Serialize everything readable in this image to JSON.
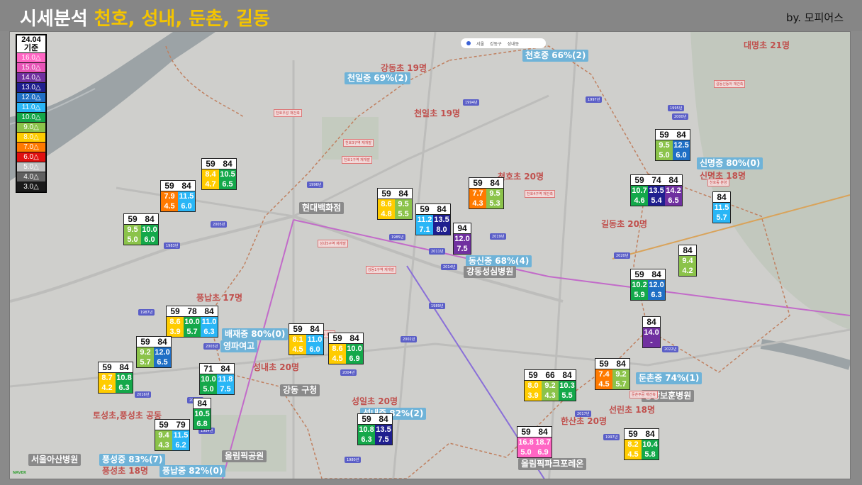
{
  "header": {
    "title_plain": "시세분석 ",
    "title_highlight": "천호, 성내, 둔촌, 길동",
    "credit": "by. 모피어스"
  },
  "legend": {
    "header": [
      "24.04",
      "기준"
    ],
    "items": [
      {
        "label": "16.0△",
        "bg": "#ff66c4",
        "fg": "#ffffff"
      },
      {
        "label": "15.0△",
        "bg": "#e754b7",
        "fg": "#ffffff"
      },
      {
        "label": "14.0△",
        "bg": "#7030a0",
        "fg": "#ffffff"
      },
      {
        "label": "13.0△",
        "bg": "#1f1f8f",
        "fg": "#ffffff"
      },
      {
        "label": "12.0△",
        "bg": "#1f6fc5",
        "fg": "#ffffff"
      },
      {
        "label": "11.0△",
        "bg": "#29b6f6",
        "fg": "#ffffff"
      },
      {
        "label": "10.0△",
        "bg": "#14a84a",
        "fg": "#ffffff"
      },
      {
        "label": "9.0△",
        "bg": "#8bc34a",
        "fg": "#ffffff"
      },
      {
        "label": "8.0△",
        "bg": "#ffcc00",
        "fg": "#ffffff"
      },
      {
        "label": "7.0△",
        "bg": "#ff7a00",
        "fg": "#ffffff"
      },
      {
        "label": "6.0△",
        "bg": "#e01010",
        "fg": "#ffffff"
      },
      {
        "label": "5.0△",
        "bg": "#c0c0c0",
        "fg": "#ffffff"
      },
      {
        "label": "4.0△",
        "bg": "#606060",
        "fg": "#ffffff"
      },
      {
        "label": "3.0△",
        "bg": "#1a1a1a",
        "fg": "#ffffff"
      }
    ]
  },
  "search": {
    "items": [
      "서울",
      "강동구",
      "성내동"
    ]
  },
  "labels": [
    {
      "text": "대명초 21명",
      "cls": "school"
    },
    {
      "text": "천호중 66%(2)",
      "cls": "mid"
    },
    {
      "text": "강동초 19명",
      "cls": "school"
    },
    {
      "text": "천일중 69%(2)",
      "cls": "mid"
    },
    {
      "text": "천일초 19명",
      "cls": "school"
    },
    {
      "text": "천호초 20명",
      "cls": "school"
    },
    {
      "text": "신명중 80%(0)",
      "cls": "mid"
    },
    {
      "text": "신명초 18명",
      "cls": "school"
    },
    {
      "text": "현대백화점",
      "cls": "place"
    },
    {
      "text": "길동초 20명",
      "cls": "school"
    },
    {
      "text": "동신중 68%(4)",
      "cls": "mid"
    },
    {
      "text": "강동성심병원",
      "cls": "place"
    },
    {
      "text": "풍납초 17명",
      "cls": "school"
    },
    {
      "text": "배재중 80%(0)",
      "cls": "mid"
    },
    {
      "text": "영파여고",
      "cls": "mid"
    },
    {
      "text": "성내초 20명",
      "cls": "school"
    },
    {
      "text": "강동 구청",
      "cls": "place"
    },
    {
      "text": "둔촌중 74%(1)",
      "cls": "mid"
    },
    {
      "text": "중앙보훈병원",
      "cls": "place"
    },
    {
      "text": "성일초 20명",
      "cls": "school"
    },
    {
      "text": "성내중 82%(2)",
      "cls": "mid"
    },
    {
      "text": "선린초 18명",
      "cls": "school"
    },
    {
      "text": "토성초,풍성초 공동",
      "cls": "school"
    },
    {
      "text": "한산초 20명",
      "cls": "school"
    },
    {
      "text": "올림픽공원",
      "cls": "place"
    },
    {
      "text": "올림픽파크포레온",
      "cls": "place"
    },
    {
      "text": "서울아산병원",
      "cls": "place"
    },
    {
      "text": "풍성중 83%(7)",
      "cls": "mid"
    },
    {
      "text": "풍성초 18명",
      "cls": "school"
    },
    {
      "text": "풍납중 82%(0)",
      "cls": "mid"
    }
  ],
  "cards": [
    {
      "sizes": [
        "59",
        "84"
      ],
      "rows": [
        [
          {
            "v": "9.5",
            "c": "#8bc34a"
          },
          {
            "v": "12.5",
            "c": "#1f6fc5"
          }
        ],
        [
          {
            "v": "5.0",
            "c": "#8bc34a"
          },
          {
            "v": "6.0",
            "c": "#1f6fc5"
          }
        ]
      ]
    },
    {
      "sizes": [
        "59",
        "84"
      ],
      "rows": [
        [
          {
            "v": "8.4",
            "c": "#ffcc00"
          },
          {
            "v": "10.5",
            "c": "#14a84a"
          }
        ],
        [
          {
            "v": "4.7",
            "c": "#ffcc00"
          },
          {
            "v": "6.5",
            "c": "#14a84a"
          }
        ]
      ]
    },
    {
      "sizes": [
        "59",
        "84"
      ],
      "rows": [
        [
          {
            "v": "7.9",
            "c": "#ff7a00"
          },
          {
            "v": "11.5",
            "c": "#29b6f6"
          }
        ],
        [
          {
            "v": "4.5",
            "c": "#ff7a00"
          },
          {
            "v": "6.0",
            "c": "#29b6f6"
          }
        ]
      ]
    },
    {
      "sizes": [
        "59",
        "84"
      ],
      "rows": [
        [
          {
            "v": "9.5",
            "c": "#8bc34a"
          },
          {
            "v": "10.0",
            "c": "#14a84a"
          }
        ],
        [
          {
            "v": "5.0",
            "c": "#8bc34a"
          },
          {
            "v": "6.0",
            "c": "#14a84a"
          }
        ]
      ]
    },
    {
      "sizes": [
        "59",
        "84"
      ],
      "rows": [
        [
          {
            "v": "8.6",
            "c": "#ffcc00"
          },
          {
            "v": "9.5",
            "c": "#8bc34a"
          }
        ],
        [
          {
            "v": "4.8",
            "c": "#ffcc00"
          },
          {
            "v": "5.5",
            "c": "#8bc34a"
          }
        ]
      ]
    },
    {
      "sizes": [
        "59",
        "84"
      ],
      "rows": [
        [
          {
            "v": "11.2",
            "c": "#29b6f6"
          },
          {
            "v": "13.5",
            "c": "#1f1f8f"
          }
        ],
        [
          {
            "v": "7.1",
            "c": "#29b6f6"
          },
          {
            "v": "8.0",
            "c": "#1f1f8f"
          }
        ]
      ]
    },
    {
      "sizes": [
        "94"
      ],
      "rows": [
        [
          {
            "v": "12.0",
            "c": "#7030a0"
          }
        ],
        [
          {
            "v": "7.5",
            "c": "#7030a0"
          }
        ]
      ]
    },
    {
      "sizes": [
        "59",
        "84"
      ],
      "rows": [
        [
          {
            "v": "7.7",
            "c": "#ff7a00"
          },
          {
            "v": "9.5",
            "c": "#8bc34a"
          }
        ],
        [
          {
            "v": "4.3",
            "c": "#ff7a00"
          },
          {
            "v": "5.3",
            "c": "#8bc34a"
          }
        ]
      ]
    },
    {
      "sizes": [
        "59",
        "74",
        "84"
      ],
      "rows": [
        [
          {
            "v": "10.7",
            "c": "#14a84a"
          },
          {
            "v": "13.5",
            "c": "#1f1f8f"
          },
          {
            "v": "14.2",
            "c": "#7030a0"
          }
        ],
        [
          {
            "v": "4.6",
            "c": "#14a84a"
          },
          {
            "v": "5.4",
            "c": "#1f1f8f"
          },
          {
            "v": "6.5",
            "c": "#7030a0"
          }
        ]
      ]
    },
    {
      "sizes": [
        "84"
      ],
      "rows": [
        [
          {
            "v": "11.5",
            "c": "#29b6f6"
          }
        ],
        [
          {
            "v": "5.7",
            "c": "#29b6f6"
          }
        ]
      ]
    },
    {
      "sizes": [
        "84"
      ],
      "rows": [
        [
          {
            "v": "9.4",
            "c": "#8bc34a"
          }
        ],
        [
          {
            "v": "4.2",
            "c": "#8bc34a"
          }
        ]
      ]
    },
    {
      "sizes": [
        "59",
        "84"
      ],
      "rows": [
        [
          {
            "v": "10.2",
            "c": "#14a84a"
          },
          {
            "v": "12.0",
            "c": "#1f6fc5"
          }
        ],
        [
          {
            "v": "5.9",
            "c": "#14a84a"
          },
          {
            "v": "6.3",
            "c": "#1f6fc5"
          }
        ]
      ]
    },
    {
      "sizes": [
        "84"
      ],
      "rows": [
        [
          {
            "v": "14.0",
            "c": "#7030a0"
          }
        ],
        [
          {
            "v": "-",
            "c": "#7030a0"
          }
        ]
      ]
    },
    {
      "sizes": [
        "59",
        "78",
        "84"
      ],
      "rows": [
        [
          {
            "v": "8.6",
            "c": "#ffcc00"
          },
          {
            "v": "10.0",
            "c": "#14a84a"
          },
          {
            "v": "11.0",
            "c": "#29b6f6"
          }
        ],
        [
          {
            "v": "3.9",
            "c": "#ffcc00"
          },
          {
            "v": "5.7",
            "c": "#14a84a"
          },
          {
            "v": "6.3",
            "c": "#29b6f6"
          }
        ]
      ]
    },
    {
      "sizes": [
        "59",
        "84"
      ],
      "rows": [
        [
          {
            "v": "8.1",
            "c": "#ffcc00"
          },
          {
            "v": "11.0",
            "c": "#29b6f6"
          }
        ],
        [
          {
            "v": "4.5",
            "c": "#ffcc00"
          },
          {
            "v": "6.0",
            "c": "#29b6f6"
          }
        ]
      ]
    },
    {
      "sizes": [
        "59",
        "84"
      ],
      "rows": [
        [
          {
            "v": "8.6",
            "c": "#ffcc00"
          },
          {
            "v": "10.0",
            "c": "#14a84a"
          }
        ],
        [
          {
            "v": "4.5",
            "c": "#ffcc00"
          },
          {
            "v": "6.9",
            "c": "#14a84a"
          }
        ]
      ]
    },
    {
      "sizes": [
        "59",
        "84"
      ],
      "rows": [
        [
          {
            "v": "9.2",
            "c": "#8bc34a"
          },
          {
            "v": "12.0",
            "c": "#1f6fc5"
          }
        ],
        [
          {
            "v": "5.7",
            "c": "#8bc34a"
          },
          {
            "v": "6.5",
            "c": "#1f6fc5"
          }
        ]
      ]
    },
    {
      "sizes": [
        "59",
        "84"
      ],
      "rows": [
        [
          {
            "v": "8.7",
            "c": "#ffcc00"
          },
          {
            "v": "10.8",
            "c": "#14a84a"
          }
        ],
        [
          {
            "v": "4.2",
            "c": "#ffcc00"
          },
          {
            "v": "6.3",
            "c": "#14a84a"
          }
        ]
      ]
    },
    {
      "sizes": [
        "71",
        "84"
      ],
      "rows": [
        [
          {
            "v": "10.0",
            "c": "#14a84a"
          },
          {
            "v": "11.8",
            "c": "#29b6f6"
          }
        ],
        [
          {
            "v": "5.0",
            "c": "#14a84a"
          },
          {
            "v": "7.5",
            "c": "#29b6f6"
          }
        ]
      ]
    },
    {
      "sizes": [
        "84"
      ],
      "rows": [
        [
          {
            "v": "10.5",
            "c": "#14a84a"
          }
        ],
        [
          {
            "v": "6.8",
            "c": "#14a84a"
          }
        ]
      ]
    },
    {
      "sizes": [
        "59",
        "79"
      ],
      "rows": [
        [
          {
            "v": "9.4",
            "c": "#8bc34a"
          },
          {
            "v": "11.5",
            "c": "#29b6f6"
          }
        ],
        [
          {
            "v": "4.3",
            "c": "#8bc34a"
          },
          {
            "v": "6.2",
            "c": "#29b6f6"
          }
        ]
      ]
    },
    {
      "sizes": [
        "59",
        "84"
      ],
      "rows": [
        [
          {
            "v": "10.8",
            "c": "#14a84a"
          },
          {
            "v": "13.5",
            "c": "#1f1f8f"
          }
        ],
        [
          {
            "v": "6.3",
            "c": "#14a84a"
          },
          {
            "v": "7.5",
            "c": "#1f1f8f"
          }
        ]
      ]
    },
    {
      "sizes": [
        "59",
        "66",
        "84"
      ],
      "rows": [
        [
          {
            "v": "8.0",
            "c": "#ffcc00"
          },
          {
            "v": "9.2",
            "c": "#8bc34a"
          },
          {
            "v": "10.3",
            "c": "#14a84a"
          }
        ],
        [
          {
            "v": "3.9",
            "c": "#ffcc00"
          },
          {
            "v": "4.3",
            "c": "#8bc34a"
          },
          {
            "v": "5.5",
            "c": "#14a84a"
          }
        ]
      ]
    },
    {
      "sizes": [
        "59",
        "84"
      ],
      "rows": [
        [
          {
            "v": "7.4",
            "c": "#ff7a00"
          },
          {
            "v": "9.2",
            "c": "#8bc34a"
          }
        ],
        [
          {
            "v": "4.5",
            "c": "#ff7a00"
          },
          {
            "v": "5.7",
            "c": "#8bc34a"
          }
        ]
      ]
    },
    {
      "sizes": [
        "59",
        "84"
      ],
      "rows": [
        [
          {
            "v": "16.8",
            "c": "#ff66c4"
          },
          {
            "v": "18.7",
            "c": "#ff66c4"
          }
        ],
        [
          {
            "v": "5.0",
            "c": "#ff66c4"
          },
          {
            "v": "6.9",
            "c": "#ff66c4"
          }
        ]
      ]
    },
    {
      "sizes": [
        "59",
        "84"
      ],
      "rows": [
        [
          {
            "v": "8.2",
            "c": "#ffcc00"
          },
          {
            "v": "10.4",
            "c": "#14a84a"
          }
        ],
        [
          {
            "v": "4.5",
            "c": "#ffcc00"
          },
          {
            "v": "5.8",
            "c": "#14a84a"
          }
        ]
      ]
    }
  ],
  "apt_tags": [
    "1997년",
    "1994년",
    "1995년",
    "2000년",
    "1996년",
    "2005년",
    "1983년",
    "1985년",
    "2011년",
    "2014년",
    "2019년",
    "2020년",
    "2021년",
    "2022년",
    "1987년",
    "2003년",
    "2016년",
    "2018년",
    "1984년",
    "1980년",
    "1997년",
    "2017년",
    "2002년",
    "1989년",
    "2004년"
  ],
  "pins": [
    "천호우성 재건축",
    "천호3구역 재개발",
    "천호1구역 재개발",
    "천호4구역 재건축",
    "성내5구역 재개발",
    "길동신동아 재건축",
    "둔촌주공 재건축",
    "강동1구역 재개발",
    "천호동 분양",
    "성내동 분양"
  ],
  "footer": {
    "logo": "NAVER"
  }
}
